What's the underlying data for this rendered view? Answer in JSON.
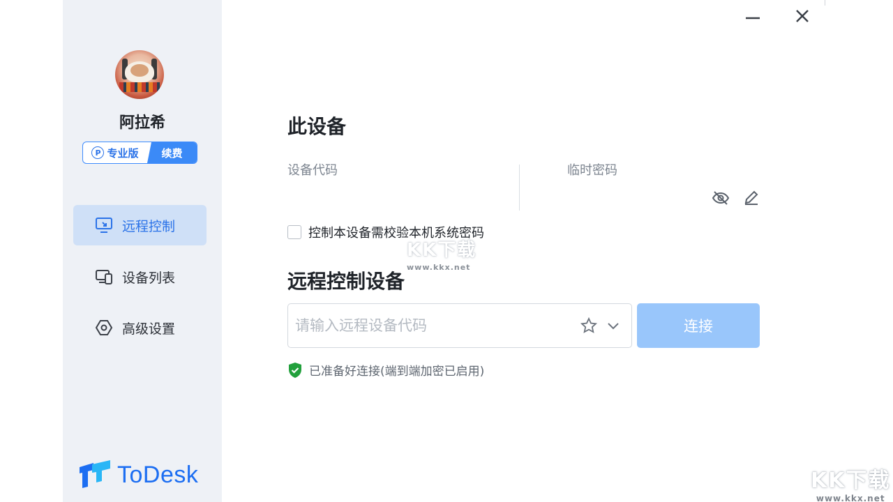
{
  "user": {
    "name": "阿拉希",
    "badge_edition": "专业版",
    "badge_edition_icon_letter": "P",
    "badge_renew": "续费"
  },
  "nav": {
    "items": [
      {
        "label": "远程控制",
        "icon": "monitor-remote-icon",
        "active": true
      },
      {
        "label": "设备列表",
        "icon": "devices-icon",
        "active": false
      },
      {
        "label": "高级设置",
        "icon": "settings-hexagon-icon",
        "active": false
      }
    ]
  },
  "brand": {
    "logo_text": "ToDesk",
    "color": "#1c6ef2"
  },
  "this_device": {
    "title": "此设备",
    "code_label": "设备代码",
    "password_label": "临时密码",
    "checkbox_label": "控制本设备需校验本机系统密码",
    "checkbox_checked": false
  },
  "remote": {
    "title": "远程控制设备",
    "input_placeholder": "请输入远程设备代码",
    "connect_label": "连接"
  },
  "status": {
    "text": "已准备好连接(端到端加密已启用)",
    "color": "#22a03c"
  },
  "watermark": {
    "text": "KK下载",
    "url": "www.kkx.net"
  },
  "colors": {
    "accent": "#2a72e8",
    "connect_button": "#99c6fb",
    "sidebar_bg": "#eef1f6",
    "active_nav_bg": "#cfe0f7"
  }
}
